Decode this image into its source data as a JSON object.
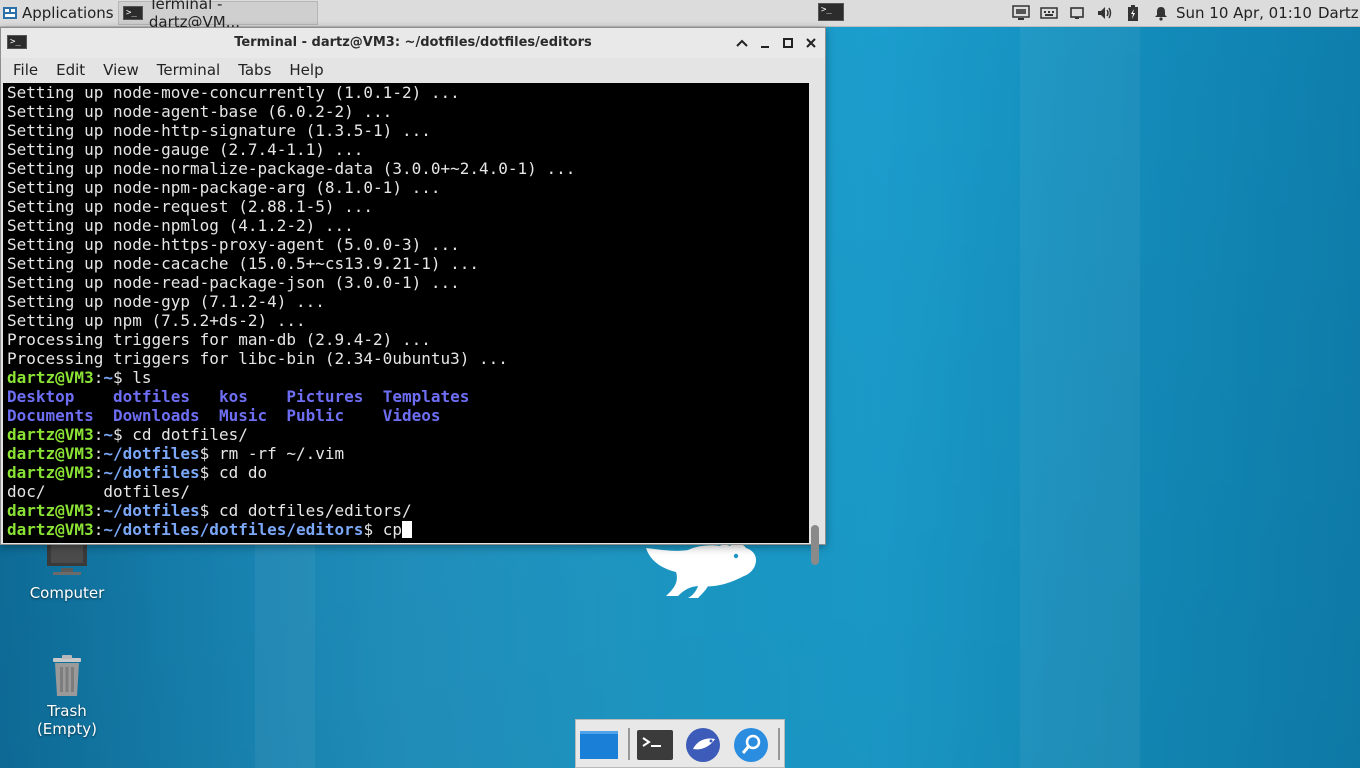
{
  "panel": {
    "applications_label": "Applications",
    "task_label": "Terminal - dartz@VM...",
    "clock": "Sun 10 Apr, 01:10",
    "user": "Dartz",
    "tray_icons": [
      "network-icon",
      "keyboard-icon",
      "display-icon",
      "volume-icon",
      "battery-icon",
      "notification-bell-icon"
    ]
  },
  "desktop": {
    "icons": [
      {
        "label": "Computer",
        "icon": "computer-icon"
      },
      {
        "label": "Trash",
        "sublabel": "(Empty)",
        "icon": "trash-icon"
      }
    ]
  },
  "window": {
    "title": "Terminal - dartz@VM3: ~/dotfiles/dotfiles/editors",
    "menu": [
      "File",
      "Edit",
      "View",
      "Terminal",
      "Tabs",
      "Help"
    ],
    "controls": [
      "shade-button",
      "minimize-button",
      "maximize-button",
      "close-button"
    ]
  },
  "terminal": {
    "output_lines": [
      "Setting up node-move-concurrently (1.0.1-2) ...",
      "Setting up node-agent-base (6.0.2-2) ...",
      "Setting up node-http-signature (1.3.5-1) ...",
      "Setting up node-gauge (2.7.4-1.1) ...",
      "Setting up node-normalize-package-data (3.0.0+~2.4.0-1) ...",
      "Setting up node-npm-package-arg (8.1.0-1) ...",
      "Setting up node-request (2.88.1-5) ...",
      "Setting up node-npmlog (4.1.2-2) ...",
      "Setting up node-https-proxy-agent (5.0.0-3) ...",
      "Setting up node-cacache (15.0.5+~cs13.9.21-1) ...",
      "Setting up node-read-package-json (3.0.0-1) ...",
      "Setting up node-gyp (7.1.2-4) ...",
      "Setting up npm (7.5.2+ds-2) ...",
      "Processing triggers for man-db (2.9.4-2) ...",
      "Processing triggers for libc-bin (2.34-0ubuntu3) ..."
    ],
    "prompt_user": "dartz@VM3",
    "prompts": [
      {
        "path": "~",
        "cmd": "ls"
      },
      {
        "path": "~",
        "cmd": "cd dotfiles/"
      },
      {
        "path": "~/dotfiles",
        "cmd": "rm -rf ~/.vim"
      },
      {
        "path": "~/dotfiles",
        "cmd": "cd do"
      },
      {
        "path": "~/dotfiles",
        "cmd": "cd dotfiles/editors/"
      },
      {
        "path": "~/dotfiles/dotfiles/editors",
        "cmd": "cp"
      }
    ],
    "ls_row1": [
      "Desktop",
      "dotfiles",
      "kos",
      "Pictures",
      "Templates"
    ],
    "ls_row2": [
      "Documents",
      "Downloads",
      "Music",
      "Public",
      "Videos"
    ],
    "completion_row": [
      "doc/",
      "dotfiles/"
    ]
  },
  "dock": {
    "items": [
      "show-desktop-icon",
      "terminal-icon",
      "web-browser-icon",
      "app-finder-icon"
    ]
  },
  "colors": {
    "prompt_user": "#8ae234",
    "prompt_path": "#7aa7f7",
    "directory": "#6e6ef5",
    "terminal_bg": "#000000",
    "desktop_bg": "#1a98c6"
  }
}
